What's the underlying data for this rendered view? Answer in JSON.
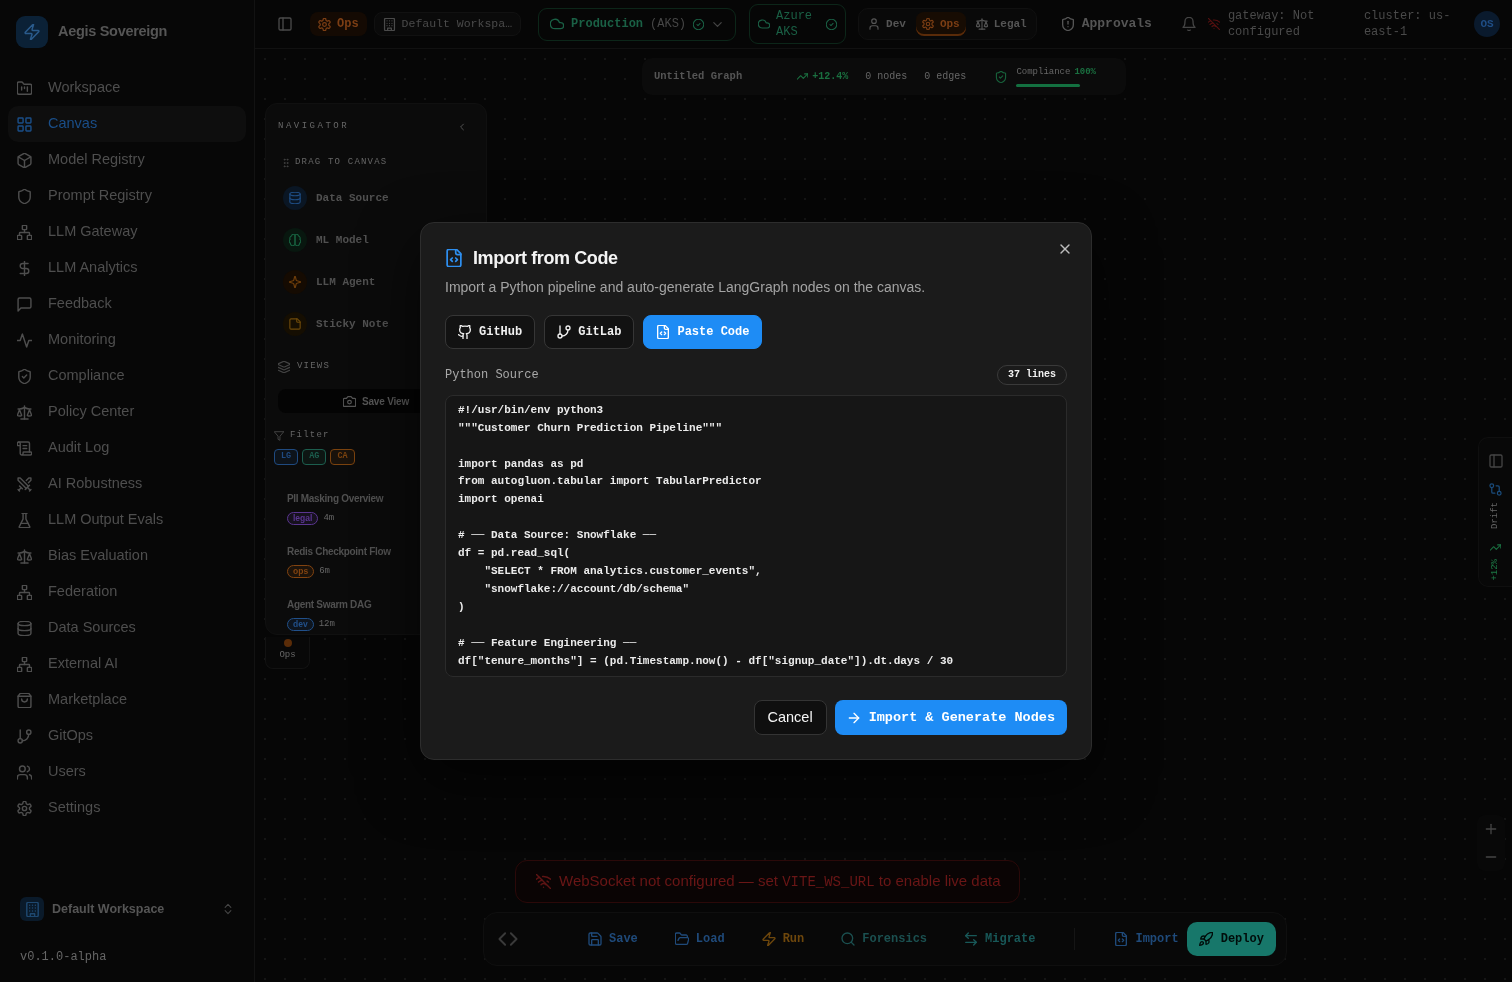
{
  "sidebar": {
    "brand": "Aegis Sovereign",
    "items": [
      {
        "label": "Workspace",
        "selected": false
      },
      {
        "label": "Canvas",
        "selected": true
      },
      {
        "label": "Model Registry",
        "selected": false
      },
      {
        "label": "Prompt Registry",
        "selected": false
      },
      {
        "label": "LLM Gateway",
        "selected": false
      },
      {
        "label": "LLM Analytics",
        "selected": false
      },
      {
        "label": "Feedback",
        "selected": false
      },
      {
        "label": "Monitoring",
        "selected": false
      },
      {
        "label": "Compliance",
        "selected": false
      },
      {
        "label": "Policy Center",
        "selected": false
      },
      {
        "label": "Audit Log",
        "selected": false
      },
      {
        "label": "AI Robustness",
        "selected": false
      },
      {
        "label": "LLM Output Evals",
        "selected": false
      },
      {
        "label": "Bias Evaluation",
        "selected": false
      },
      {
        "label": "Federation",
        "selected": false
      },
      {
        "label": "Data Sources",
        "selected": false
      },
      {
        "label": "External AI",
        "selected": false
      },
      {
        "label": "Marketplace",
        "selected": false
      },
      {
        "label": "GitOps",
        "selected": false
      },
      {
        "label": "Users",
        "selected": false
      },
      {
        "label": "Settings",
        "selected": false
      }
    ],
    "workspace": "Default Workspace",
    "version": "v0.1.0-alpha"
  },
  "topbar": {
    "role": "Ops",
    "workspace": "Default Workspa…",
    "environment": {
      "name": "Production",
      "cluster": "(AKS)"
    },
    "cloud": "Azure AKS",
    "personas": [
      {
        "label": "Dev",
        "selected": false
      },
      {
        "label": "Ops",
        "selected": true
      },
      {
        "label": "Legal",
        "selected": false
      }
    ],
    "approvals": "Approvals",
    "gateway": "gateway: Not configured",
    "cluster": "cluster: us-east-1",
    "avatar": "OS"
  },
  "graph_bar": {
    "title": "Untitled Graph",
    "trend": "+12.4%",
    "nodes": "0 nodes",
    "edges": "0 edges",
    "compliance": {
      "label": "Compliance",
      "value": "100%",
      "level": 1
    }
  },
  "navigator": {
    "title": "NAVIGATOR",
    "palette_title": "DRAG TO CANVAS",
    "palette": [
      {
        "label": "Data Source",
        "kind": "data"
      },
      {
        "label": "ML Model",
        "kind": "model"
      },
      {
        "label": "LLM Agent",
        "kind": "agent"
      },
      {
        "label": "Sticky Note",
        "kind": "note"
      }
    ],
    "views_title": "VIEWS",
    "save_view": "Save View",
    "filter_label": "Filter",
    "filters": [
      {
        "label": "LG",
        "color": "#1f4a80"
      },
      {
        "label": "AG",
        "color": "#1c5e4e"
      },
      {
        "label": "CA",
        "color": "#7a420e"
      }
    ],
    "views": [
      {
        "name": "PII Masking Overview",
        "tag": {
          "label": "legal",
          "color": "#5a3590"
        },
        "age": "4m"
      },
      {
        "name": "Redis Checkpoint Flow",
        "tag": {
          "label": "ops",
          "color": "#824310"
        },
        "age": "6m"
      },
      {
        "name": "Agent Swarm DAG",
        "tag": {
          "label": "dev",
          "color": "#21508a"
        },
        "age": "12m"
      }
    ]
  },
  "canvas_node": {
    "label": "Ops"
  },
  "right_rail": {
    "drift": "Drift",
    "trend": "+12%"
  },
  "toolbar": {
    "actions": [
      {
        "label": "Save",
        "kind": "save"
      },
      {
        "label": "Load",
        "kind": "load"
      },
      {
        "label": "Run",
        "kind": "run"
      },
      {
        "label": "Forensics",
        "kind": "forensics"
      },
      {
        "label": "Migrate",
        "kind": "migrate"
      },
      {
        "label": "Import",
        "kind": "import"
      }
    ],
    "deploy": "Deploy"
  },
  "alert": {
    "before": "WebSocket not configured — set",
    "code": "VITE_WS_URL",
    "after": "to enable live data"
  },
  "dialog": {
    "title": "Import from Code",
    "subtitle": "Import a Python pipeline and auto-generate LangGraph nodes on the canvas.",
    "sources": [
      {
        "label": "GitHub",
        "selected": false
      },
      {
        "label": "GitLab",
        "selected": false
      },
      {
        "label": "Paste Code",
        "selected": true
      }
    ],
    "field_label": "Python Source",
    "line_count": "37 lines",
    "code": "#!/usr/bin/env python3\n\"\"\"Customer Churn Prediction Pipeline\"\"\"\n\nimport pandas as pd\nfrom autogluon.tabular import TabularPredictor\nimport openai\n\n# ── Data Source: Snowflake ──\ndf = pd.read_sql(\n    \"SELECT * FROM analytics.customer_events\",\n    \"snowflake://account/db/schema\"\n)\n\n# ── Feature Engineering ──\ndf[\"tenure_months\"] = (pd.Timestamp.now() - df[\"signup_date\"]).dt.days / 30",
    "cancel": "Cancel",
    "submit": "Import & Generate Nodes"
  }
}
